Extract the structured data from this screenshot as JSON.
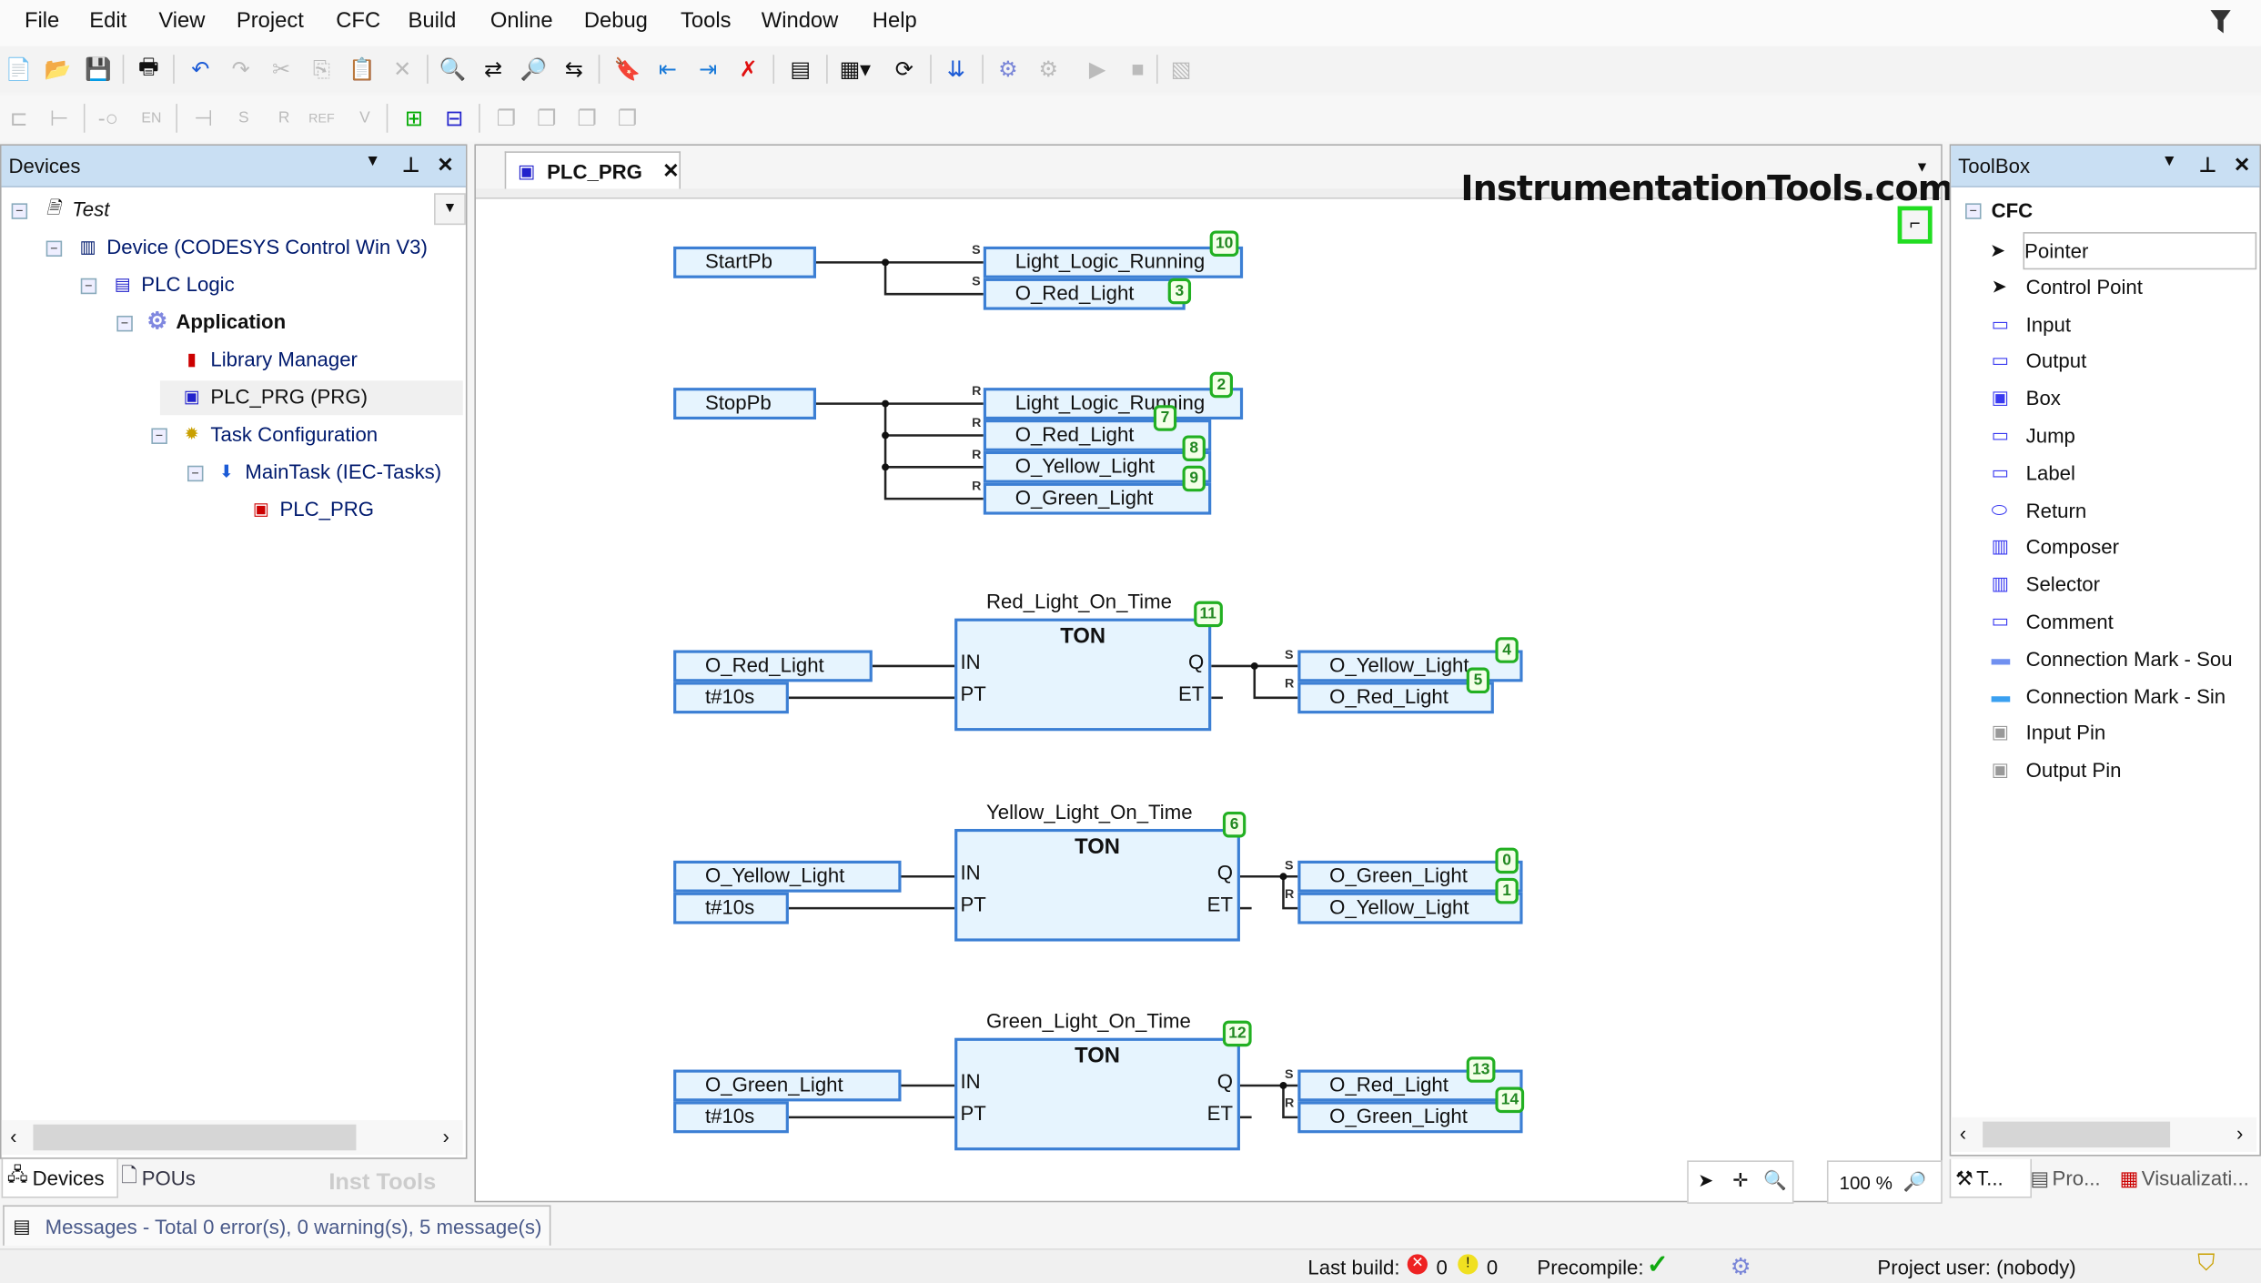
{
  "menu": [
    "File",
    "Edit",
    "View",
    "Project",
    "CFC",
    "Build",
    "Online",
    "Debug",
    "Tools",
    "Window",
    "Help"
  ],
  "devices_panel": {
    "title": "Devices",
    "tree": [
      {
        "label": "Test",
        "icon": "project-icon",
        "italic": true
      },
      {
        "label": "Device (CODESYS Control Win V3)",
        "icon": "device-icon"
      },
      {
        "label": "PLC Logic",
        "icon": "plc-logic-icon"
      },
      {
        "label": "Application",
        "icon": "application-gear-icon",
        "bold": true
      },
      {
        "label": "Library Manager",
        "icon": "library-icon"
      },
      {
        "label": "PLC_PRG (PRG)",
        "icon": "pou-icon",
        "selected": true
      },
      {
        "label": "Task Configuration",
        "icon": "task-config-icon"
      },
      {
        "label": "MainTask (IEC-Tasks)",
        "icon": "task-icon"
      },
      {
        "label": "PLC_PRG",
        "icon": "program-call-icon"
      }
    ],
    "tabs": [
      "Devices",
      "POUs"
    ],
    "watermark": "Inst Tools"
  },
  "editor": {
    "tab_label": "PLC_PRG",
    "watermark": "InstrumentationTools.com",
    "zoom_level": "100 %",
    "networks": {
      "start": {
        "input": "StartPb",
        "outputs": [
          {
            "name": "Light_Logic_Running",
            "mod": "S",
            "order": "10"
          },
          {
            "name": "O_Red_Light",
            "mod": "S",
            "order": "3"
          }
        ]
      },
      "stop": {
        "input": "StopPb",
        "outputs": [
          {
            "name": "Light_Logic_Running",
            "mod": "R",
            "order": "2"
          },
          {
            "name": "O_Red_Light",
            "mod": "R",
            "order": "7"
          },
          {
            "name": "O_Yellow_Light",
            "mod": "R",
            "order": "8"
          },
          {
            "name": "O_Green_Light",
            "mod": "R",
            "order": "9"
          }
        ]
      },
      "timers": [
        {
          "instance": "Red_Light_On_Time",
          "type": "TON",
          "order": "11",
          "in": "O_Red_Light",
          "pt": "t#10s",
          "outputs": [
            {
              "name": "O_Yellow_Light",
              "mod": "S",
              "order": "4"
            },
            {
              "name": "O_Red_Light",
              "mod": "R",
              "order": "5"
            }
          ]
        },
        {
          "instance": "Yellow_Light_On_Time",
          "type": "TON",
          "order": "6",
          "in": "O_Yellow_Light",
          "pt": "t#10s",
          "outputs": [
            {
              "name": "O_Green_Light",
              "mod": "S",
              "order": "0"
            },
            {
              "name": "O_Yellow_Light",
              "mod": "R",
              "order": "1"
            }
          ]
        },
        {
          "instance": "Green_Light_On_Time",
          "type": "TON",
          "order": "12",
          "in": "O_Green_Light",
          "pt": "t#10s",
          "outputs": [
            {
              "name": "O_Red_Light",
              "mod": "S",
              "order": "13"
            },
            {
              "name": "O_Green_Light",
              "mod": "R",
              "order": "14"
            }
          ]
        }
      ],
      "pins": {
        "in": "IN",
        "pt": "PT",
        "q": "Q",
        "et": "ET"
      }
    }
  },
  "toolbox": {
    "title": "ToolBox",
    "group": "CFC",
    "items": [
      "Pointer",
      "Control Point",
      "Input",
      "Output",
      "Box",
      "Jump",
      "Label",
      "Return",
      "Composer",
      "Selector",
      "Comment",
      "Connection Mark - Sou",
      "Connection Mark - Sin",
      "Input Pin",
      "Output Pin"
    ],
    "tabs": [
      "T...",
      "Pro...",
      "Visualizati..."
    ]
  },
  "messages": "Messages - Total 0 error(s), 0 warning(s), 5 message(s)",
  "status": {
    "last_build_label": "Last build:",
    "errors": "0",
    "warnings": "0",
    "precompile_label": "Precompile:",
    "project_user": "Project user: (nobody)"
  }
}
